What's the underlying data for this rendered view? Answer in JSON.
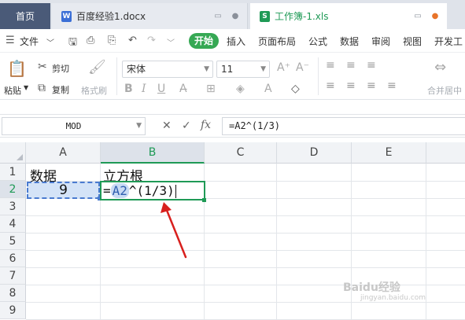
{
  "tabs": {
    "home_label": "首页",
    "doc_label": "百度经验1.docx",
    "doc_icon": "W",
    "xls_label": "工作簿-1.xls",
    "xls_icon": "S"
  },
  "menu": {
    "file": "文件",
    "items": [
      "开始",
      "插入",
      "页面布局",
      "公式",
      "数据",
      "审阅",
      "视图",
      "开发工"
    ]
  },
  "ribbon": {
    "paste": "粘贴",
    "cut": "剪切",
    "copy": "复制",
    "format_painter": "格式刷",
    "font_name": "宋体",
    "font_size": "11",
    "merge_center": "合并居中"
  },
  "formula_bar": {
    "name_box": "MOD",
    "formula": "=A2^(1/3)"
  },
  "grid": {
    "columns": [
      "A",
      "B",
      "C",
      "D",
      "E"
    ],
    "rows": [
      "1",
      "2",
      "3",
      "4",
      "5",
      "6",
      "7",
      "8",
      "9"
    ],
    "A1": "数据",
    "B1": "立方根",
    "A2": "9",
    "B2_prefix": "=",
    "B2_ref": "A2",
    "B2_suffix": "^(1/3)"
  },
  "watermark": {
    "main": "Baidu经验",
    "sub": "jingyan.baidu.com"
  },
  "colors": {
    "accent_green": "#1f9a56",
    "start_button": "#36a854",
    "reference_blue": "#4a7bd0",
    "arrow_red": "#d8201e"
  }
}
